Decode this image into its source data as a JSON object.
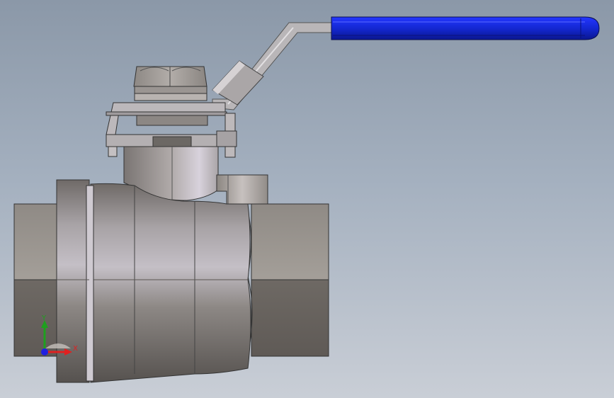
{
  "viewport": {
    "background_top": "#8b98a8",
    "background_bottom": "#c9ced6"
  },
  "model": {
    "subject": "ball-valve",
    "handle_grip_color": "#1428d2",
    "body_color": "#9b958f"
  },
  "triad": {
    "x_label": "X",
    "y_label": "Y",
    "x_color": "#e02020",
    "y_color": "#1ea01e",
    "z_color": "#2020e0"
  }
}
